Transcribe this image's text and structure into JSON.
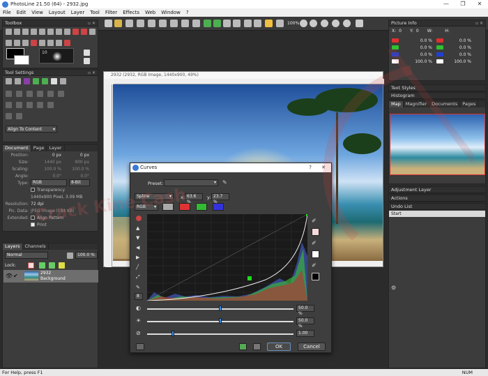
{
  "window": {
    "title": "PhotoLine 21.50 (64) - 2932.jpg",
    "controls": [
      "—",
      "❐",
      "✕"
    ]
  },
  "menu": [
    "File",
    "Edit",
    "View",
    "Layout",
    "Layer",
    "Tool",
    "Filter",
    "Effects",
    "Web",
    "Window",
    "?"
  ],
  "toolbar": {
    "zoom_label": "100%"
  },
  "toolbox": {
    "title": "Toolbox",
    "brush_size": "10"
  },
  "tool_settings": {
    "title": "Tool Settings",
    "align_select": "Align To Content"
  },
  "document_panel": {
    "tabs": [
      "Document",
      "Page",
      "Layer"
    ],
    "rows": [
      {
        "key": "Position:",
        "v1": "0 px",
        "v2": "0 px"
      },
      {
        "key": "Size:",
        "v1": "1440 px",
        "v2": "900 px"
      },
      {
        "key": "Scaling:",
        "v1": "100.0 %",
        "v2": "100.0 %"
      },
      {
        "key": "Angle:",
        "v1": "0.0°",
        "v2": "0.0°"
      }
    ],
    "type_label": "Type:",
    "type_value": "RGB",
    "bits_value": "8-Bit",
    "transparency": "Transparency",
    "pixels_info": "1440x900 Pixel, 3.09 MB",
    "resolution_label": "Resolution:",
    "resolution_value": "72 dpi",
    "picdata_label": "Pic. Data:",
    "picdata_value": "JPEG Image (184 KB)",
    "extended_label": "Extended:",
    "align_pattern": "Align Pattern",
    "print": "Print"
  },
  "layers_panel": {
    "tabs": [
      "Layers",
      "Channels"
    ],
    "mode": "Normal",
    "opacity": "100.0 %",
    "lock_label": "Lock:",
    "layer_name": "2932",
    "layer_sub": "Background"
  },
  "document_window": {
    "title": "2932 (2932, RGB Image, 1440x900, 49%)"
  },
  "curves_dialog": {
    "title": "Curves",
    "help": "?",
    "close": "✕",
    "preset_label": "Preset:",
    "preset_value": "",
    "mode": "Spline",
    "x_label": "x:",
    "x_value": "63.6 %",
    "y_label": "y:",
    "y_value": "23.7 %",
    "channel": "RGB",
    "page_field": "8",
    "sliders": [
      {
        "value": "50.0 %",
        "position": 0.5
      },
      {
        "value": "50.0 %",
        "position": 0.5
      },
      {
        "value": "1.00",
        "position": 0.18
      }
    ],
    "ok_label": "OK",
    "cancel_label": "Cancel"
  },
  "picture_info": {
    "title": "Picture Info",
    "x_label": "X:",
    "x_value": "0",
    "y_label": "Y:",
    "y_value": "0",
    "w_label": "W:",
    "h_label": "H:",
    "rows": [
      {
        "left": "0.0 %",
        "right": "0.0 %",
        "color": "#e03030"
      },
      {
        "left": "0.0 %",
        "right": "0.0 %",
        "color": "#30c030"
      },
      {
        "left": "0.0 %",
        "right": "0.0 %",
        "color": "#2040d0"
      },
      {
        "left": "100.0 %",
        "right": "100.0 %",
        "color": "#ffffff"
      }
    ]
  },
  "right_panels": {
    "text_styles": "Text Styles",
    "histogram": "Histogram",
    "map_tabs": [
      "Map",
      "Magnifier",
      "Documents",
      "Pages"
    ],
    "adjustment_layer": "Adjustment Layer",
    "actions": "Actions",
    "undo_list": "Undo List",
    "undo_item": "Start"
  },
  "status": {
    "help": "For Help, press F1",
    "num": "NUM"
  },
  "watermark_text": "Crack Kine Cash"
}
